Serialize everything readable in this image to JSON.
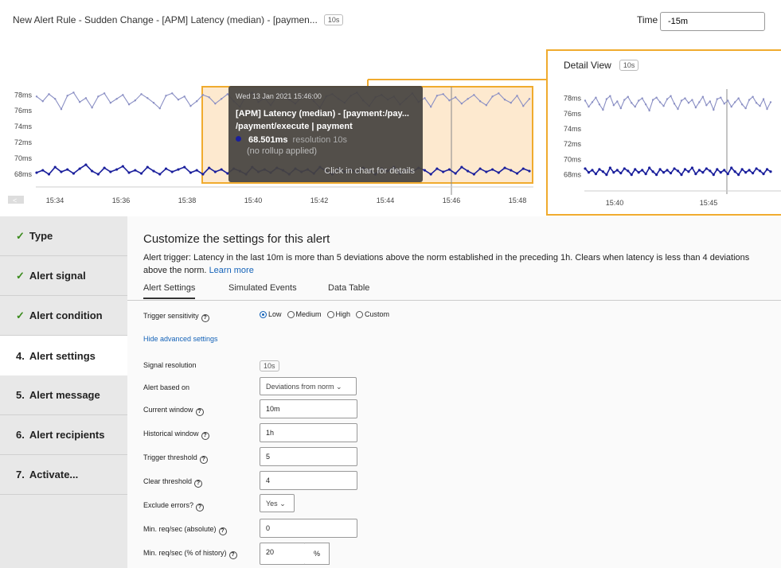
{
  "header": {
    "title": "New Alert Rule - Sudden Change - [APM] Latency (median) - [paymen...",
    "resolution_badge": "10s",
    "time_label": "Time",
    "time_value": "-15m"
  },
  "main_chart": {
    "y_ticks": [
      "78ms",
      "76ms",
      "74ms",
      "72ms",
      "70ms",
      "68ms"
    ],
    "x_ticks": [
      "15:34",
      "15:36",
      "15:38",
      "15:40",
      "15:42",
      "15:44",
      "15:46",
      "15:48"
    ],
    "nav_left_glyph": "<"
  },
  "tooltip": {
    "date": "Wed 13 Jan 2021 15:46:00",
    "title_line1": "[APM] Latency (median) - [payment:/pay...",
    "title_line2": "/payment/execute | payment",
    "value": "68.501ms",
    "resolution": "resolution 10s",
    "rollup": "(no rollup applied)",
    "hint": "Click in chart for details"
  },
  "detail_view": {
    "title": "Detail View",
    "badge": "10s",
    "y_ticks": [
      "78ms",
      "76ms",
      "74ms",
      "72ms",
      "70ms",
      "68ms"
    ],
    "x_ticks": [
      "15:40",
      "15:45"
    ]
  },
  "chart_data": {
    "type": "line",
    "ylabel": "",
    "ylim": [
      66.5,
      79
    ],
    "x_range": [
      "15:33",
      "15:48"
    ],
    "series": [
      {
        "values": [
          77.8,
          77.2,
          78.1,
          77.5,
          76.2,
          77.9,
          78.3,
          77.1,
          77.6,
          76.4,
          77.8,
          78.2,
          77.0,
          77.5,
          78.0,
          76.8,
          77.3,
          78.1,
          77.6,
          77.0,
          76.3,
          77.9,
          78.2,
          77.4,
          77.8,
          76.6,
          77.2,
          78.0,
          77.7,
          76.9,
          77.5,
          78.1,
          77.2,
          76.5,
          77.9,
          78.3,
          77.1,
          77.6,
          76.7,
          77.8,
          78.2,
          77.4,
          76.9,
          77.7,
          78.0,
          77.2,
          76.4,
          77.8,
          78.1,
          77.5,
          77.0,
          77.9,
          78.3,
          77.3,
          76.6,
          77.7,
          78.0,
          77.4,
          77.8,
          76.8,
          77.5,
          78.2,
          77.1,
          77.6,
          76.5,
          77.9,
          78.1,
          77.3,
          77.7,
          76.9,
          77.5,
          78.0,
          77.2,
          76.7,
          77.8,
          78.2,
          77.4,
          77.0,
          77.9,
          76.6,
          77.5
        ]
      },
      {
        "values": [
          68.2,
          68.5,
          68.0,
          68.9,
          68.3,
          68.6,
          68.1,
          68.7,
          69.2,
          68.4,
          68.0,
          68.8,
          68.3,
          68.6,
          69.0,
          68.2,
          68.5,
          68.1,
          68.9,
          68.4,
          68.0,
          68.7,
          68.3,
          68.6,
          68.9,
          68.2,
          68.5,
          68.0,
          68.8,
          68.3,
          68.6,
          68.1,
          68.7,
          68.4,
          68.0,
          68.9,
          68.3,
          68.6,
          68.2,
          68.8,
          68.5,
          68.0,
          68.7,
          68.3,
          68.6,
          68.1,
          68.9,
          68.4,
          68.0,
          68.7,
          68.3,
          68.6,
          68.2,
          68.8,
          68.5,
          68.0,
          68.7,
          68.4,
          68.9,
          68.1,
          68.6,
          68.3,
          68.8,
          68.5,
          68.0,
          68.7,
          68.3,
          68.6,
          68.1,
          68.9,
          68.4,
          68.0,
          68.7,
          68.3,
          68.6,
          68.2,
          68.8,
          68.5,
          68.1,
          68.7,
          68.4
        ]
      }
    ]
  },
  "sidebar": {
    "items": [
      {
        "label": "Type",
        "prefix": "✓",
        "done": true
      },
      {
        "label": "Alert signal",
        "prefix": "✓",
        "done": true
      },
      {
        "label": "Alert condition",
        "prefix": "✓",
        "done": true
      },
      {
        "label": "Alert settings",
        "prefix": "4.",
        "done": false,
        "active": true
      },
      {
        "label": "Alert message",
        "prefix": "5.",
        "done": false
      },
      {
        "label": "Alert recipients",
        "prefix": "6.",
        "done": false
      },
      {
        "label": "Activate...",
        "prefix": "7.",
        "done": false
      }
    ]
  },
  "main": {
    "heading": "Customize the settings for this alert",
    "description": "Alert trigger: Latency in the last 10m is more than 5 deviations above the norm established in the preceding 1h. Clears when latency is less than 4 deviations above the norm.",
    "learn_more": "Learn more",
    "tabs": [
      "Alert Settings",
      "Simulated Events",
      "Data Table"
    ],
    "sensitivity_label": "Trigger sensitivity",
    "sensitivity_options": [
      "Low",
      "Medium",
      "High",
      "Custom"
    ],
    "advanced_link": "Hide advanced settings",
    "signal_resolution_label": "Signal resolution",
    "signal_resolution_value": "10s",
    "alert_based_on_label": "Alert based on",
    "alert_based_on_value": "Deviations from norm",
    "current_window_label": "Current window",
    "current_window_value": "10m",
    "historical_window_label": "Historical window",
    "historical_window_value": "1h",
    "trigger_threshold_label": "Trigger threshold",
    "trigger_threshold_value": "5",
    "clear_threshold_label": "Clear threshold",
    "clear_threshold_value": "4",
    "exclude_errors_label": "Exclude errors?",
    "exclude_errors_value": "Yes",
    "min_req_abs_label": "Min. req/sec (absolute)",
    "min_req_abs_value": "0",
    "min_req_pct_label": "Min. req/sec (% of history)",
    "min_req_pct_value": "20",
    "pct_unit": "%"
  },
  "colors": {
    "upper_series": "#8a8fc4",
    "lower_series": "#1a1f9c",
    "highlight": "#f0ab2e",
    "link": "#1563b8",
    "check": "#3a8a1c"
  }
}
